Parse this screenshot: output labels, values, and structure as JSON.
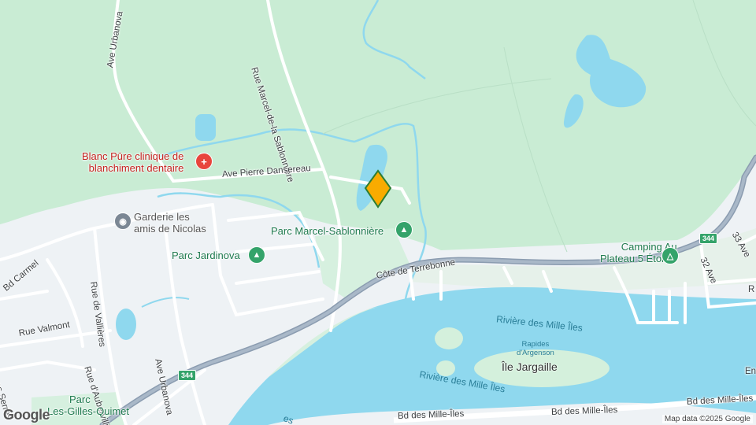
{
  "map": {
    "colors": {
      "land": "#e8f5ec",
      "green": "#c9ecd4",
      "water": "#8fd8ee",
      "road": "#ffffff",
      "highway": "#8b9cb0",
      "park_text": "#1e7a4e",
      "marker": "#f9ab00"
    }
  },
  "streets": {
    "ave_urbanova_north": "Ave Urbanova",
    "rue_marcel": "Rue Marcel-de-la Sablonnière",
    "ave_pierre": "Ave Pierre Dansereau",
    "bd_carmel": "Bd Carmel",
    "rue_vallieres": "Rue de Vallières",
    "rue_valmont": "Rue Valmont",
    "rue_aubervilliers": "Rue d'Aubervilliers",
    "ave_urbanova_south": "Ave Urbanova",
    "serres": "es Serres",
    "cote_terrebonne": "Côte de Terrebonne",
    "bd_mille_iles_1": "Bd des Mille-Îles",
    "bd_mille_iles_2": "Bd des Mille-Îles",
    "bd_mille_iles_3": "Bd des Mille-Îles",
    "ave_33": "33 Ave",
    "ave_32": "32 Ave",
    "route_r": "R",
    "route_e": "En"
  },
  "pois": {
    "clinic": "Blanc Pūre clinique de blanchiment dentaire",
    "clinic_line1": "Blanc Pūre clinique de",
    "clinic_line2": "blanchiment dentaire",
    "garderie_line1": "Garderie les",
    "garderie_line2": "amis de Nicolas",
    "parc_marcel": "Parc Marcel-Sablonnière",
    "parc_jardinova": "Parc Jardinova",
    "camping_line1": "Camping Au",
    "camping_line2": "Plateau 5 Étoiles",
    "parc_gilles_line1": "Parc",
    "parc_gilles_line2": "Les-Gilles-Quimet"
  },
  "water": {
    "riviere_1": "Rivière des Mille Îles",
    "riviere_2": "Rivière des Mille Îles",
    "rapides_line1": "Rapides",
    "rapides_line2": "d'Argenson",
    "island": "Île Jargaille",
    "partial": "es"
  },
  "shields": {
    "route_344_west": "344",
    "route_344_east": "344"
  },
  "attribution": "Map data ©2025 Google",
  "logo": "Google"
}
